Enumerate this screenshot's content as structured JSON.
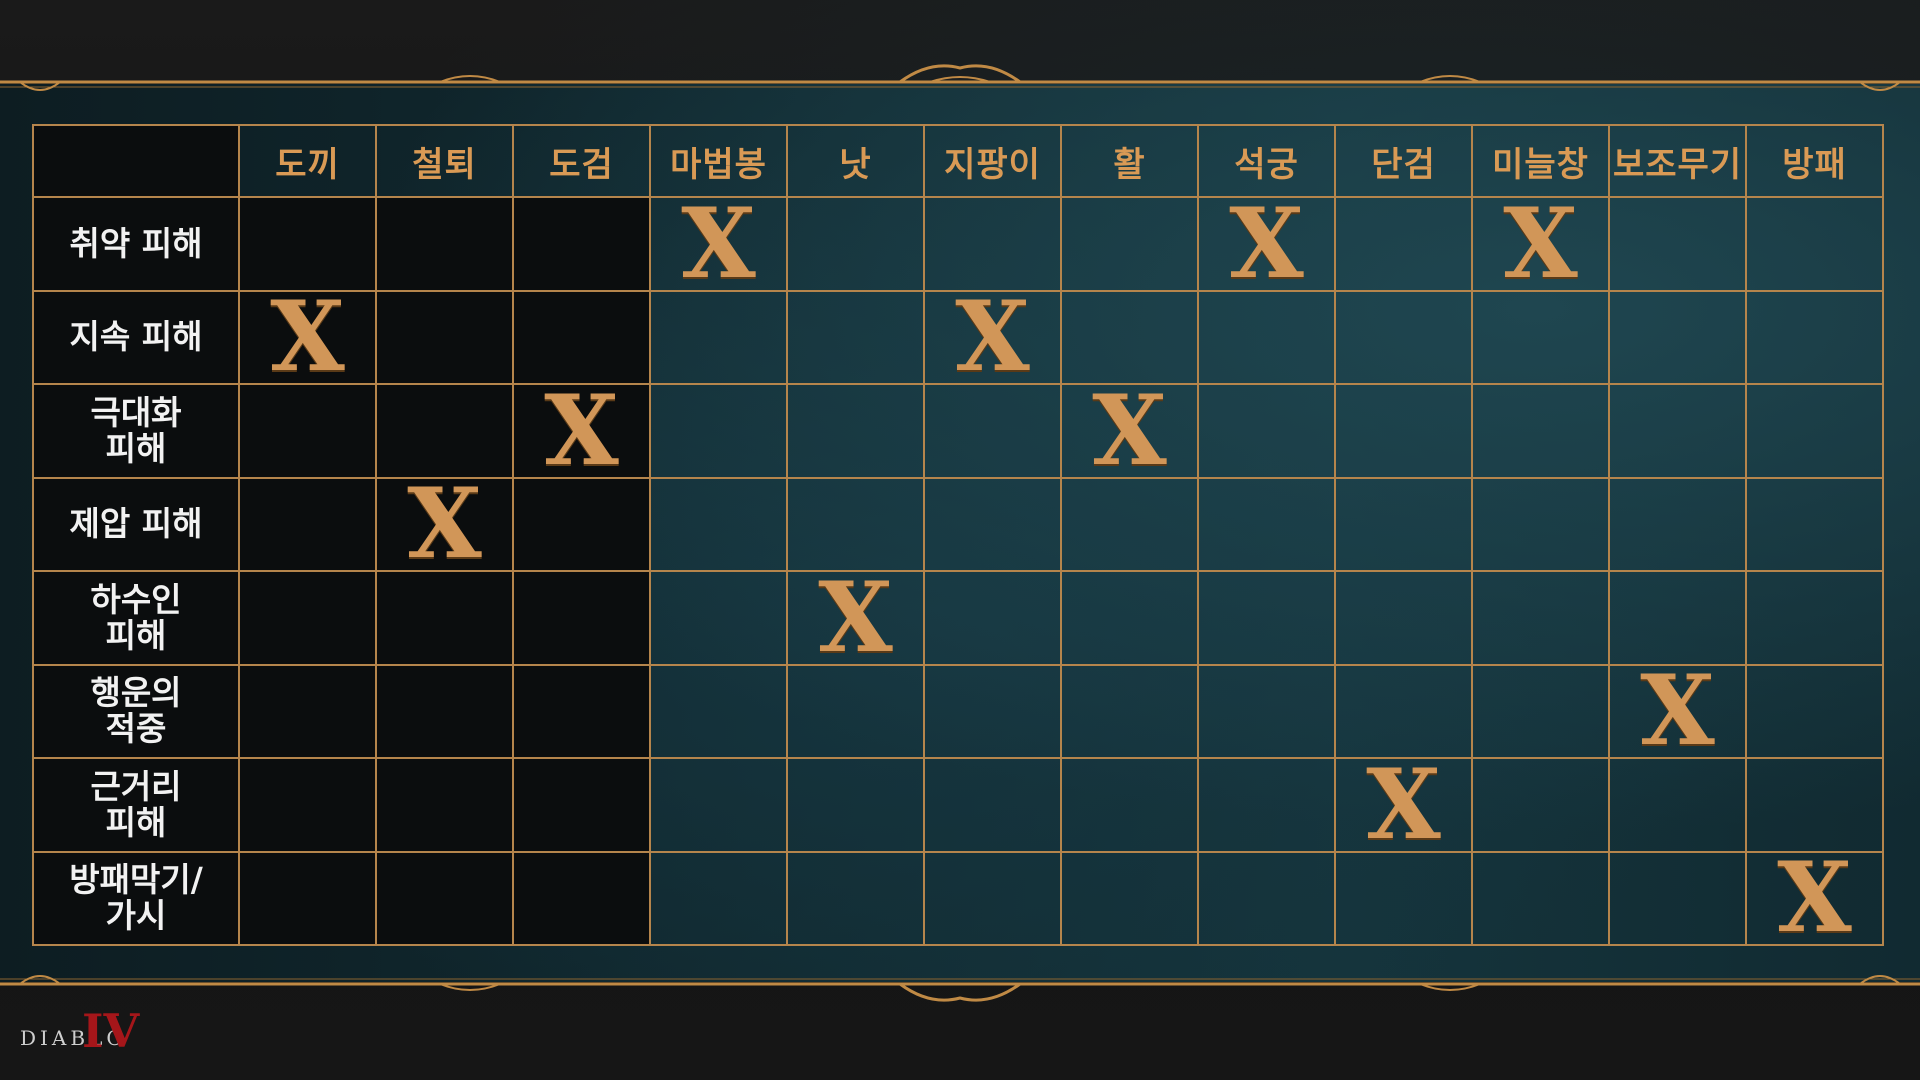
{
  "brand": {
    "logo_text": "DIABLO",
    "logo_numeral": "IV"
  },
  "colors": {
    "accent": "#d99a55",
    "grid": "#b5854c",
    "mark": "#d19658",
    "logo_numeral": "#a5161a"
  },
  "chart_data": {
    "type": "table",
    "columns": [
      "도끼",
      "철퇴",
      "도검",
      "마법봉",
      "낫",
      "지팡이",
      "활",
      "석궁",
      "단검",
      "미늘창",
      "보조무기",
      "방패"
    ],
    "rows": [
      {
        "label": "취약 피해",
        "cells": [
          "",
          "",
          "",
          "X",
          "",
          "",
          "",
          "X",
          "",
          "X",
          "",
          ""
        ]
      },
      {
        "label": "지속 피해",
        "cells": [
          "X",
          "",
          "",
          "",
          "",
          "X",
          "",
          "",
          "",
          "",
          "",
          ""
        ]
      },
      {
        "label": "극대화\n피해",
        "cells": [
          "",
          "",
          "X",
          "",
          "",
          "",
          "X",
          "",
          "",
          "",
          "",
          ""
        ]
      },
      {
        "label": "제압 피해",
        "cells": [
          "",
          "X",
          "",
          "",
          "",
          "",
          "",
          "",
          "",
          "",
          "",
          ""
        ]
      },
      {
        "label": "하수인\n피해",
        "cells": [
          "",
          "",
          "",
          "",
          "X",
          "",
          "",
          "",
          "",
          "",
          "",
          ""
        ]
      },
      {
        "label": "행운의\n적중",
        "cells": [
          "",
          "",
          "",
          "",
          "",
          "",
          "",
          "",
          "",
          "",
          "X",
          ""
        ]
      },
      {
        "label": "근거리\n피해",
        "cells": [
          "",
          "",
          "",
          "",
          "",
          "",
          "",
          "",
          "X",
          "",
          "",
          ""
        ]
      },
      {
        "label": "방패막기/\n가시",
        "cells": [
          "",
          "",
          "",
          "",
          "",
          "",
          "",
          "",
          "",
          "",
          "",
          "X"
        ]
      }
    ]
  }
}
